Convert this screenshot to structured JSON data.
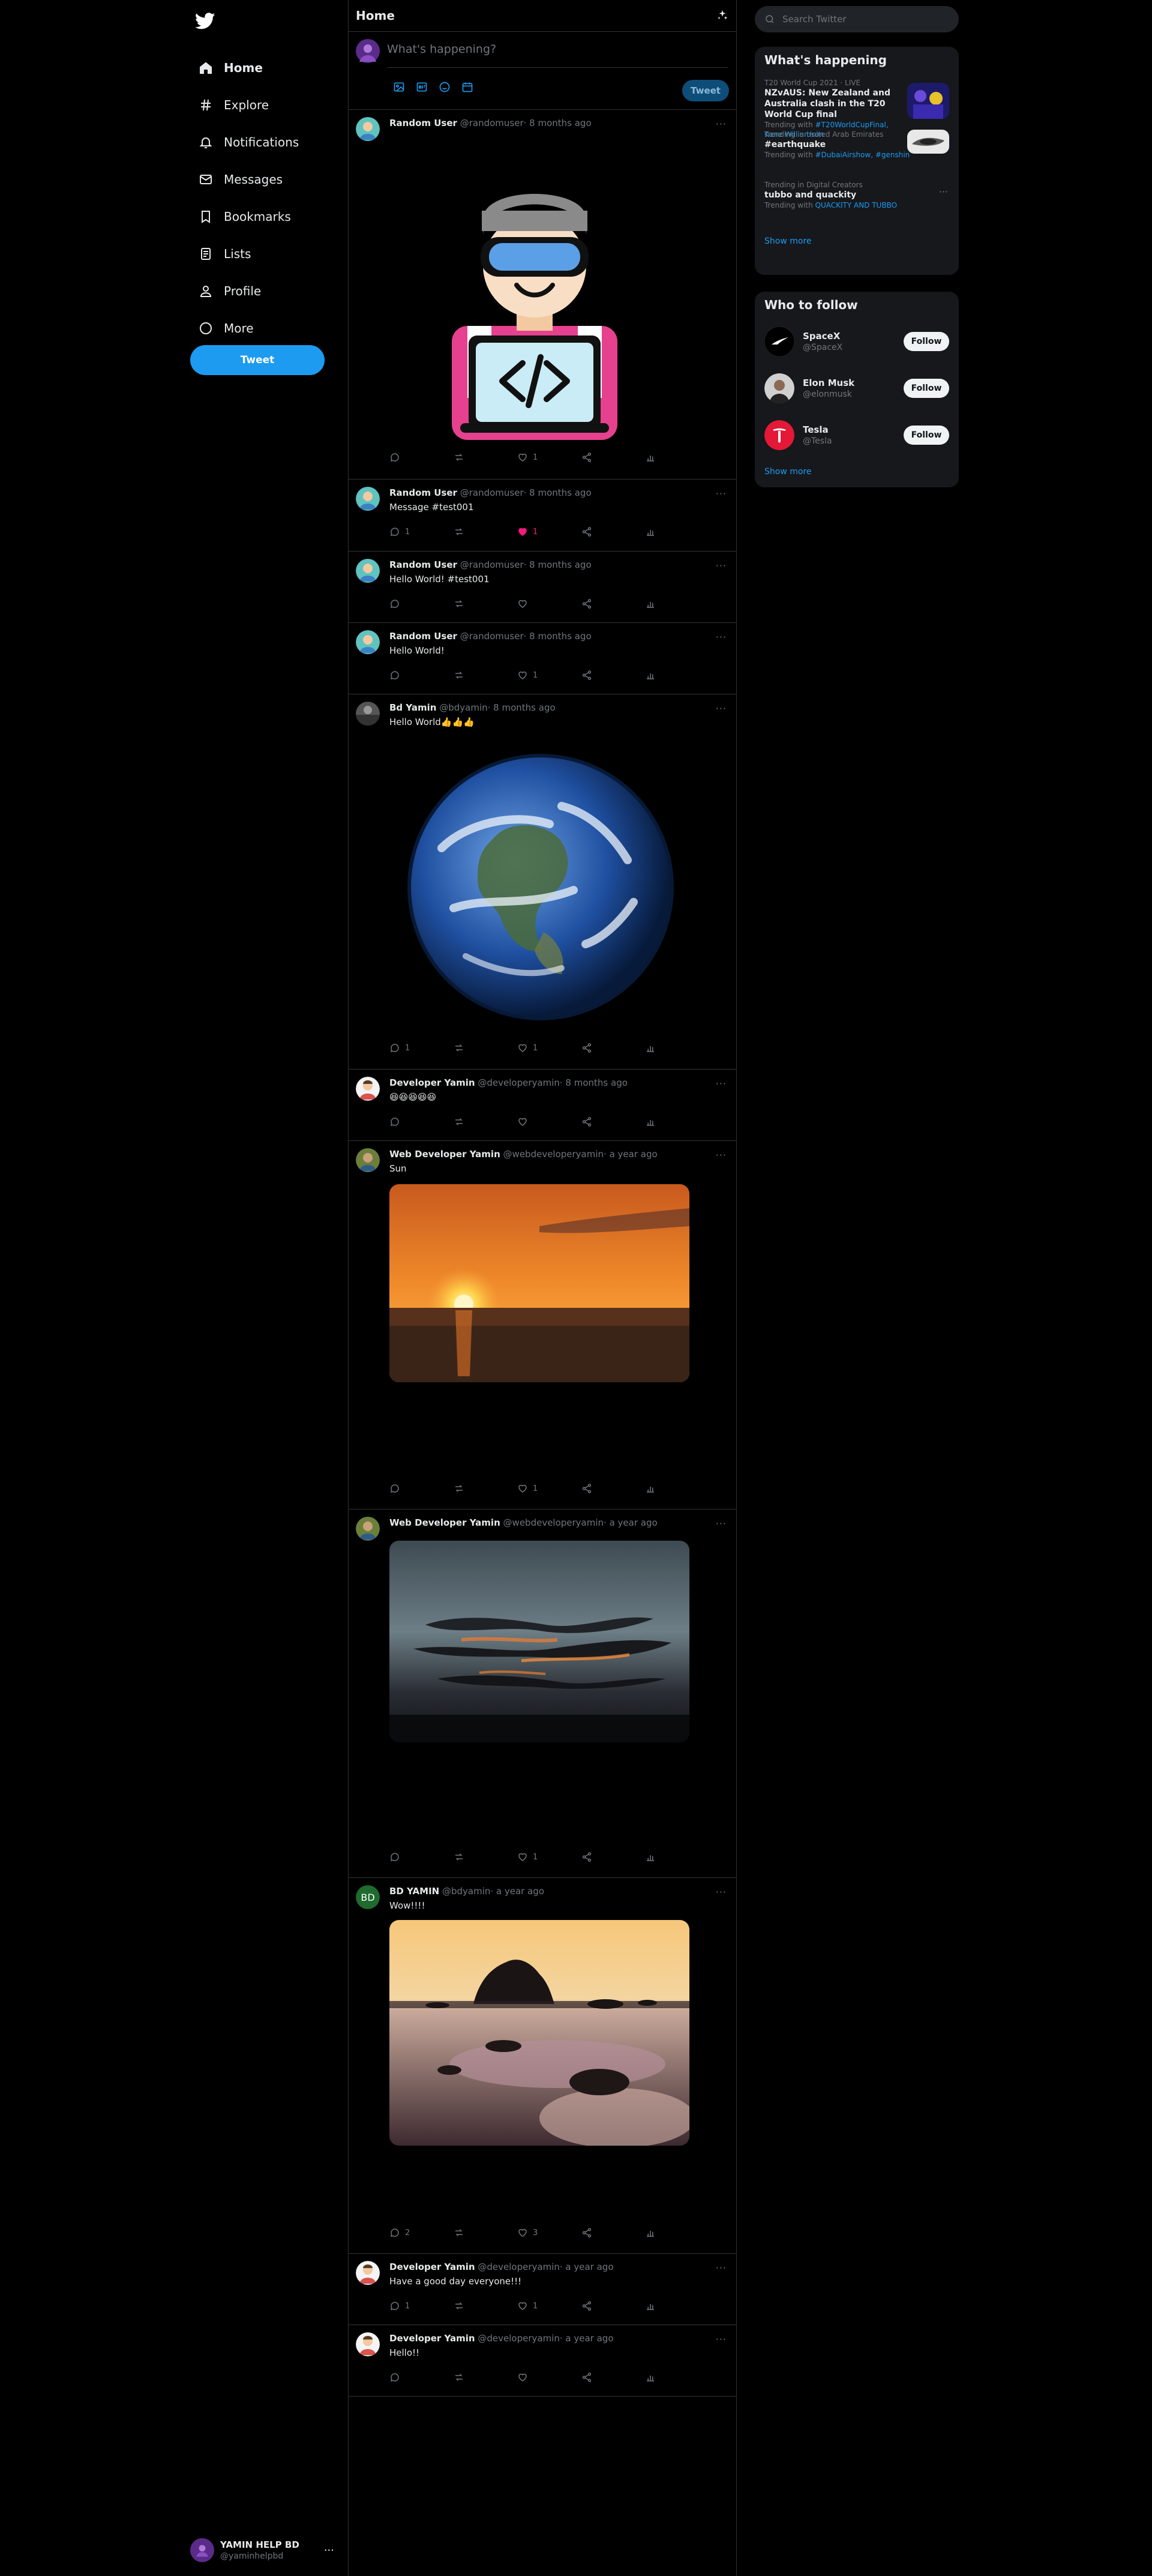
{
  "sidebar": {
    "items": [
      {
        "label": "Home",
        "icon": "home-icon"
      },
      {
        "label": "Explore",
        "icon": "hashtag-icon"
      },
      {
        "label": "Notifications",
        "icon": "bell-icon"
      },
      {
        "label": "Messages",
        "icon": "envelope-icon"
      },
      {
        "label": "Bookmarks",
        "icon": "bookmark-icon"
      },
      {
        "label": "Lists",
        "icon": "list-icon"
      },
      {
        "label": "Profile",
        "icon": "person-icon"
      },
      {
        "label": "More",
        "icon": "more-circle-icon"
      }
    ],
    "tweet_button": "Tweet",
    "account": {
      "name": "YAMIN HELP BD",
      "handle": "@yaminhelpbd"
    }
  },
  "main": {
    "title": "Home",
    "composer": {
      "placeholder": "What's happening?",
      "post_label": "Tweet"
    },
    "tweets": [
      {
        "name": "Random User",
        "handle": "@randomuser",
        "time": "· 8 months ago",
        "text": "",
        "replies": "",
        "retweets": "",
        "likes": "1",
        "liked": false
      },
      {
        "name": "Random User",
        "handle": "@randomuser",
        "time": "· 8 months ago",
        "text": "Message #test001",
        "replies": "1",
        "retweets": "",
        "likes": "1",
        "liked": true
      },
      {
        "name": "Random User",
        "handle": "@randomuser",
        "time": "· 8 months ago",
        "text": "Hello World! #test001",
        "replies": "",
        "retweets": "",
        "likes": "",
        "liked": false
      },
      {
        "name": "Random User",
        "handle": "@randomuser",
        "time": "· 8 months ago",
        "text": "Hello World!",
        "replies": "",
        "retweets": "",
        "likes": "1",
        "liked": false
      },
      {
        "name": "Bd Yamin",
        "handle": "@bdyamin",
        "time": "· 8 months ago",
        "text": "Hello World👍👍👍",
        "replies": "1",
        "retweets": "",
        "likes": "1",
        "liked": false
      },
      {
        "name": "Developer Yamin",
        "handle": "@developeryamin",
        "time": "· 8 months ago",
        "text": "😆😆😆😆😆",
        "replies": "",
        "retweets": "",
        "likes": "",
        "liked": false
      },
      {
        "name": "Web Developer Yamin",
        "handle": "@webdeveloperyamin",
        "time": "· a year ago",
        "text": "Sun",
        "replies": "",
        "retweets": "",
        "likes": "1",
        "liked": false
      },
      {
        "name": "Web Developer Yamin",
        "handle": "@webdeveloperyamin",
        "time": "· a year ago",
        "text": "",
        "replies": "",
        "retweets": "",
        "likes": "1",
        "liked": false
      },
      {
        "name": "BD YAMIN",
        "handle": "@bdyamin",
        "time": "· a year ago",
        "text": "Wow!!!!",
        "replies": "2",
        "retweets": "",
        "likes": "3",
        "liked": false
      },
      {
        "name": "Developer Yamin",
        "handle": "@developeryamin",
        "time": "· a year ago",
        "text": "Have a good day everyone!!!",
        "replies": "1",
        "retweets": "",
        "likes": "1",
        "liked": false
      },
      {
        "name": "Developer Yamin",
        "handle": "@developeryamin",
        "time": "· a year ago",
        "text": "Hello!!",
        "replies": "",
        "retweets": "",
        "likes": "",
        "liked": false
      }
    ]
  },
  "right": {
    "search_placeholder": "Search Twitter",
    "trends_title": "What's happening",
    "trends": [
      {
        "context": "T20 World Cup 2021 · LIVE",
        "title": "NZvAUS: New Zealand and Australia clash in the T20 World Cup final",
        "with_prefix": "Trending with ",
        "with_links": "#T20WorldCupFinal, Kane Williamson"
      },
      {
        "context": "Trending in United Arab Emirates",
        "title": "#earthquake",
        "with_prefix": "Trending with ",
        "with_links": "#DubaiAirshow, #genshin"
      },
      {
        "context": "Trending in Digital Creators",
        "title": "tubbo and quackity",
        "with_prefix": "Trending with ",
        "with_links": "QUACKITY AND TUBBO"
      }
    ],
    "show_more": "Show more",
    "follow_title": "Who to follow",
    "follow": [
      {
        "name": "SpaceX",
        "handle": "@SpaceX",
        "button": "Follow"
      },
      {
        "name": "Elon Musk",
        "handle": "@elonmusk",
        "button": "Follow"
      },
      {
        "name": "Tesla",
        "handle": "@Tesla",
        "button": "Follow"
      }
    ],
    "follow_show_more": "Show more"
  },
  "colors": {
    "accent": "#1d9bf0",
    "like": "#f91880",
    "background": "#000000",
    "panel": "#16181c"
  }
}
